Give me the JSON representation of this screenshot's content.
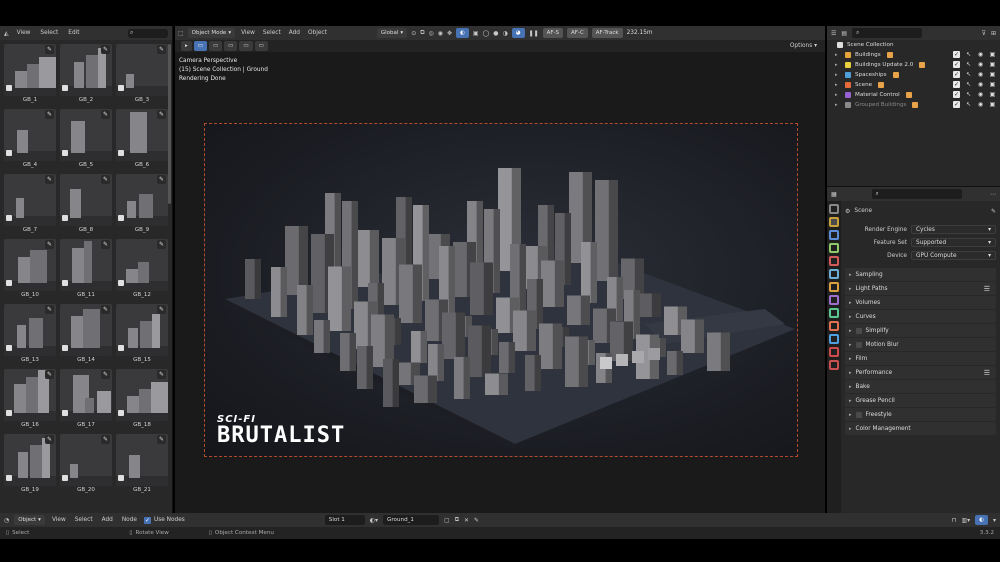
{
  "asset_browser": {
    "menus": [
      "View",
      "Select",
      "Edit"
    ],
    "items": [
      "GB_1",
      "GB_2",
      "GB_3",
      "GB_4",
      "GB_5",
      "GB_6",
      "GB_7",
      "GB_8",
      "GB_9",
      "GB_10",
      "GB_11",
      "GB_12",
      "GB_13",
      "GB_14",
      "GB_15",
      "GB_16",
      "GB_17",
      "GB_18",
      "GB_19",
      "GB_20",
      "GB_21"
    ]
  },
  "viewport": {
    "mode": "Object Mode",
    "menus": [
      "View",
      "Select",
      "Add",
      "Object"
    ],
    "transform_orientation": "Global",
    "af_s": "AF-S",
    "af_c": "AF-C",
    "af_track": "AF-Track",
    "distance": "232.15m",
    "options": "Options",
    "overlay_lines": [
      "Camera Perspective",
      "(15) Scene Collection | Ground",
      "Rendering Done"
    ],
    "logo_small": "SCI-FI",
    "logo_big": "BRUTALIST"
  },
  "outliner": {
    "root": "Scene Collection",
    "collections": [
      {
        "name": "Buildings",
        "color": "#e5a43a",
        "dim": false
      },
      {
        "name": "Buildings Update 2.0",
        "color": "#e8cf3e",
        "dim": false
      },
      {
        "name": "Spaceships",
        "color": "#4fa0d8",
        "dim": false
      },
      {
        "name": "Scene",
        "color": "#e56a3a",
        "dim": false
      },
      {
        "name": "Material Control",
        "color": "#9a5fd0",
        "dim": false
      },
      {
        "name": "Grouped Buildings",
        "color": "#8a8a8a",
        "dim": true
      }
    ]
  },
  "properties": {
    "title": "Scene",
    "render_engine_label": "Render Engine",
    "render_engine": "Cycles",
    "feature_set_label": "Feature Set",
    "feature_set": "Supported",
    "device_label": "Device",
    "device": "GPU Compute",
    "sections": [
      "Sampling",
      "Light Paths",
      "Volumes",
      "Curves",
      "Simplify",
      "Motion Blur",
      "Film",
      "Performance",
      "Bake",
      "Grease Pencil",
      "Freestyle",
      "Color Management"
    ]
  },
  "node_editor": {
    "mode": "Object",
    "menus": [
      "View",
      "Select",
      "Add",
      "Node"
    ],
    "use_nodes": "Use Nodes",
    "slot": "Slot 1",
    "material": "Ground_1"
  },
  "status_bar": {
    "hints": [
      "Select",
      "Rotate View",
      "Object Context Menu"
    ],
    "version": "3.3.2"
  },
  "colors": {
    "accent": "#4772b3",
    "camera_frame": "#b24a2d"
  }
}
